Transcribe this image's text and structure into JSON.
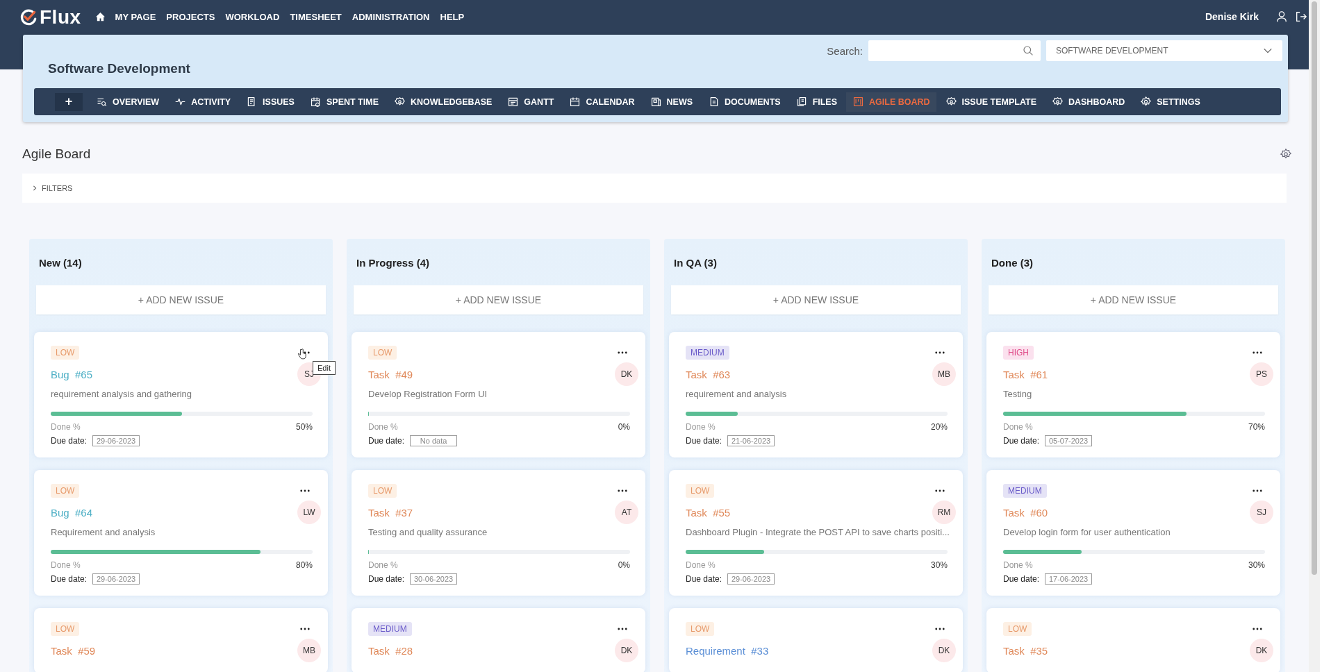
{
  "brand": {
    "name": "Flux"
  },
  "top_menu": [
    "MY PAGE",
    "PROJECTS",
    "WORKLOAD",
    "TIMESHEET",
    "ADMINISTRATION",
    "HELP"
  ],
  "user": {
    "name": "Denise Kirk"
  },
  "project": {
    "title": "Software Development",
    "search_label": "Search:",
    "project_select": "SOFTWARE DEVELOPMENT",
    "add_button": "+"
  },
  "project_nav": [
    {
      "label": "OVERVIEW",
      "selected": false
    },
    {
      "label": "ACTIVITY",
      "selected": false
    },
    {
      "label": "ISSUES",
      "selected": false
    },
    {
      "label": "SPENT TIME",
      "selected": false
    },
    {
      "label": "KNOWLEDGEBASE",
      "selected": false
    },
    {
      "label": "GANTT",
      "selected": false
    },
    {
      "label": "CALENDAR",
      "selected": false
    },
    {
      "label": "NEWS",
      "selected": false
    },
    {
      "label": "DOCUMENTS",
      "selected": false
    },
    {
      "label": "FILES",
      "selected": false
    },
    {
      "label": "AGILE BOARD",
      "selected": true
    },
    {
      "label": "ISSUE TEMPLATE",
      "selected": false
    },
    {
      "label": "DASHBOARD",
      "selected": false
    },
    {
      "label": "SETTINGS",
      "selected": false
    }
  ],
  "page": {
    "title": "Agile Board"
  },
  "filters": {
    "label": "FILTERS",
    "expanded": false
  },
  "columns": [
    {
      "title": "New (14)",
      "add_label": "+ ADD NEW ISSUE",
      "cards": [
        {
          "priority": {
            "kind": "low",
            "label": "LOW"
          },
          "tracker": {
            "kind": "bug",
            "label": "Bug"
          },
          "number": "#65",
          "assignee": "SJ",
          "subject": "requirement analysis and gathering",
          "level": 0.5,
          "done_label": "Done %",
          "done": "50%",
          "due_label": "Due date:",
          "due": "29-06-2023",
          "menu_tooltip": "Edit"
        },
        {
          "priority": {
            "kind": "low",
            "label": "LOW"
          },
          "tracker": {
            "kind": "bug",
            "label": "Bug"
          },
          "number": "#64",
          "assignee": "LW",
          "subject": "Requirement and analysis",
          "level": 0.8,
          "done_label": "Done %",
          "done": "80%",
          "due_label": "Due date:",
          "due": "29-06-2023"
        },
        {
          "priority": {
            "kind": "low",
            "label": "LOW"
          },
          "tracker": {
            "kind": "task",
            "label": "Task"
          },
          "number": "#59",
          "assignee": "MB"
        }
      ]
    },
    {
      "title": "In Progress (4)",
      "add_label": "+ ADD NEW ISSUE",
      "cards": [
        {
          "priority": {
            "kind": "low",
            "label": "LOW"
          },
          "tracker": {
            "kind": "task",
            "label": "Task"
          },
          "number": "#49",
          "assignee": "DK",
          "subject": "Develop Registration Form UI",
          "level": 0,
          "done_label": "Done %",
          "done": "0%",
          "due_label": "Due date:",
          "due": "No data"
        },
        {
          "priority": {
            "kind": "low",
            "label": "LOW"
          },
          "tracker": {
            "kind": "task",
            "label": "Task"
          },
          "number": "#37",
          "assignee": "AT",
          "subject": "Testing and quality assurance",
          "level": 0,
          "done_label": "Done %",
          "done": "0%",
          "due_label": "Due date:",
          "due": "30-06-2023"
        },
        {
          "priority": {
            "kind": "medium",
            "label": "MEDIUM"
          },
          "tracker": {
            "kind": "task",
            "label": "Task"
          },
          "number": "#28",
          "assignee": "DK"
        }
      ]
    },
    {
      "title": "In QA (3)",
      "add_label": "+ ADD NEW ISSUE",
      "cards": [
        {
          "priority": {
            "kind": "medium",
            "label": "MEDIUM"
          },
          "tracker": {
            "kind": "task",
            "label": "Task"
          },
          "number": "#63",
          "assignee": "MB",
          "subject": "requirement and analysis",
          "level": 0.2,
          "done_label": "Done %",
          "done": "20%",
          "due_label": "Due date:",
          "due": "21-06-2023"
        },
        {
          "priority": {
            "kind": "low",
            "label": "LOW"
          },
          "tracker": {
            "kind": "task",
            "label": "Task"
          },
          "number": "#55",
          "assignee": "RM",
          "subject": "Dashboard Plugin - Integrate the POST API to save charts positi...",
          "level": 0.3,
          "done_label": "Done %",
          "done": "30%",
          "due_label": "Due date:",
          "due": "29-06-2023"
        },
        {
          "priority": {
            "kind": "low",
            "label": "LOW"
          },
          "tracker": {
            "kind": "requirement",
            "label": "Requirement"
          },
          "number": "#33",
          "assignee": "DK"
        }
      ]
    },
    {
      "title": "Done (3)",
      "add_label": "+ ADD NEW ISSUE",
      "cards": [
        {
          "priority": {
            "kind": "high",
            "label": "HIGH"
          },
          "tracker": {
            "kind": "task",
            "label": "Task"
          },
          "number": "#61",
          "assignee": "PS",
          "subject": "Testing",
          "level": 0.7,
          "done_label": "Done %",
          "done": "70%",
          "due_label": "Due date:",
          "due": "05-07-2023"
        },
        {
          "priority": {
            "kind": "medium",
            "label": "MEDIUM"
          },
          "tracker": {
            "kind": "task",
            "label": "Task"
          },
          "number": "#60",
          "assignee": "SJ",
          "subject": "Develop login form for user authentication",
          "level": 0.3,
          "done_label": "Done %",
          "done": "30%",
          "due_label": "Due date:",
          "due": "17-06-2023"
        },
        {
          "priority": {
            "kind": "low",
            "label": "LOW"
          },
          "tracker": {
            "kind": "task",
            "label": "Task"
          },
          "number": "#35",
          "assignee": "DK"
        }
      ]
    }
  ]
}
